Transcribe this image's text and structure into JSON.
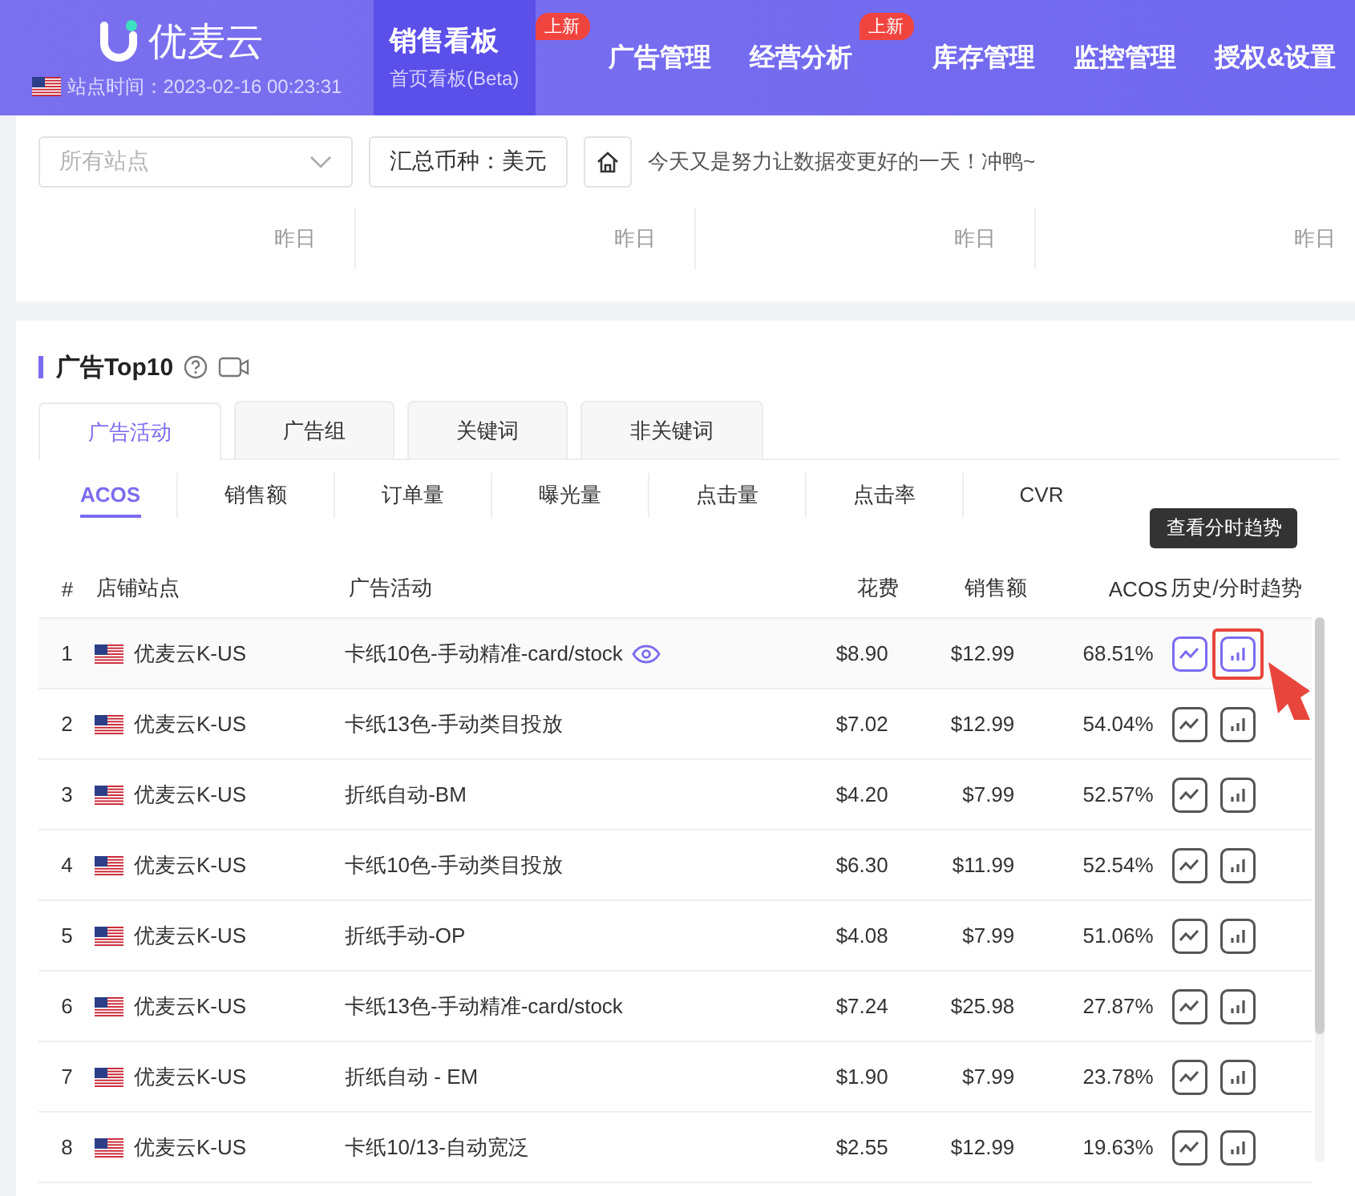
{
  "brand": {
    "name": "优麦云",
    "time": "站点时间：2023-02-16 00:23:31"
  },
  "nav": [
    {
      "label": "销售看板",
      "selected": true,
      "badge": "上新",
      "sub": "首页看板(Beta)"
    },
    {
      "label": "广告管理",
      "selected": false
    },
    {
      "label": "经营分析",
      "selected": false,
      "badge": "上新"
    },
    {
      "label": "库存管理",
      "selected": false
    },
    {
      "label": "监控管理",
      "selected": false
    },
    {
      "label": "授权&设置",
      "selected": false
    }
  ],
  "toolbar": {
    "site_select": {
      "placeholder": "所有站点"
    },
    "currency": "汇总币种：美元",
    "message": "今天又是努力让数据变更好的一天！冲鸭~"
  },
  "summary": [
    "昨日",
    "昨日",
    "昨日",
    "昨日"
  ],
  "panel": {
    "title": "广告Top10",
    "tabs": [
      {
        "label": "广告活动",
        "selected": true
      },
      {
        "label": "广告组",
        "selected": false
      },
      {
        "label": "关键词",
        "selected": false
      },
      {
        "label": "非关键词",
        "selected": false
      }
    ],
    "metrics": [
      {
        "label": "ACOS",
        "selected": true
      },
      {
        "label": "销售额",
        "selected": false
      },
      {
        "label": "订单量",
        "selected": false
      },
      {
        "label": "曝光量",
        "selected": false
      },
      {
        "label": "点击量",
        "selected": false
      },
      {
        "label": "点击率",
        "selected": false
      },
      {
        "label": "CVR",
        "selected": false
      }
    ],
    "columns": [
      "#",
      "店铺站点",
      "广告活动",
      "花费",
      "销售额",
      "ACOS",
      "历史/分时趋势"
    ],
    "tooltip": "查看分时趋势",
    "rows": [
      {
        "n": "1",
        "store": "优麦云K-US",
        "campaign": "卡纸10色-手动精准-card/stock",
        "spend": "$8.90",
        "sales": "$12.99",
        "acos": "68.51%",
        "hovered": true
      },
      {
        "n": "2",
        "store": "优麦云K-US",
        "campaign": "卡纸13色-手动类目投放",
        "spend": "$7.02",
        "sales": "$12.99",
        "acos": "54.04%",
        "hovered": false
      },
      {
        "n": "3",
        "store": "优麦云K-US",
        "campaign": "折纸自动-BM",
        "spend": "$4.20",
        "sales": "$7.99",
        "acos": "52.57%",
        "hovered": false
      },
      {
        "n": "4",
        "store": "优麦云K-US",
        "campaign": "卡纸10色-手动类目投放",
        "spend": "$6.30",
        "sales": "$11.99",
        "acos": "52.54%",
        "hovered": false
      },
      {
        "n": "5",
        "store": "优麦云K-US",
        "campaign": "折纸手动-OP",
        "spend": "$4.08",
        "sales": "$7.99",
        "acos": "51.06%",
        "hovered": false
      },
      {
        "n": "6",
        "store": "优麦云K-US",
        "campaign": "卡纸13色-手动精准-card/stock",
        "spend": "$7.24",
        "sales": "$25.98",
        "acos": "27.87%",
        "hovered": false
      },
      {
        "n": "7",
        "store": "优麦云K-US",
        "campaign": "折纸自动 - EM",
        "spend": "$1.90",
        "sales": "$7.99",
        "acos": "23.78%",
        "hovered": false
      },
      {
        "n": "8",
        "store": "优麦云K-US",
        "campaign": "卡纸10/13-自动宽泛",
        "spend": "$2.55",
        "sales": "$12.99",
        "acos": "19.63%",
        "hovered": false
      }
    ]
  }
}
